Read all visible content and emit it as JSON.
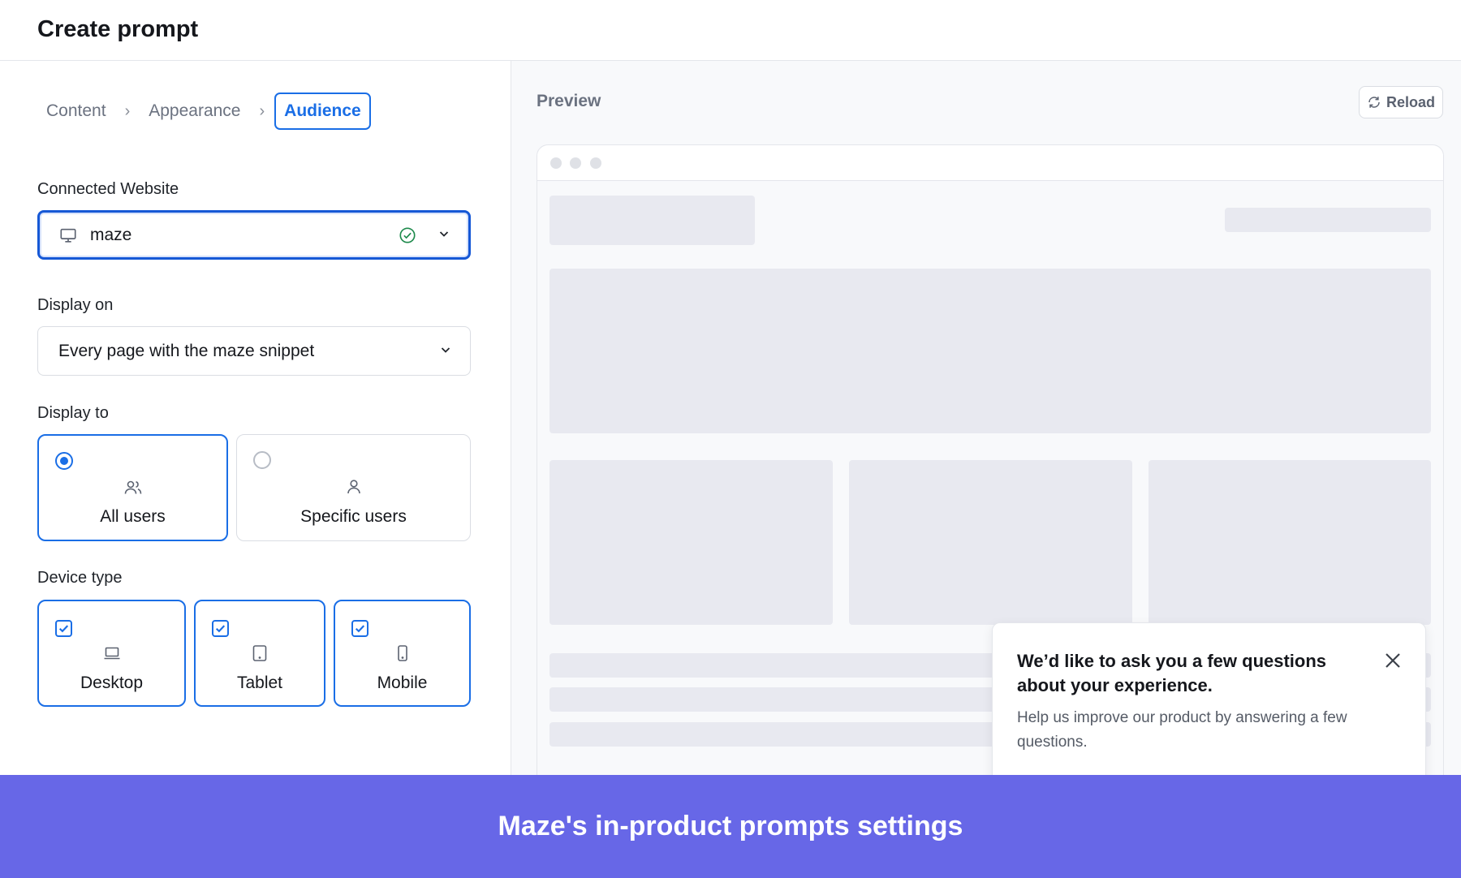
{
  "header": {
    "title": "Create prompt"
  },
  "steps": {
    "items": [
      {
        "label": "Content"
      },
      {
        "label": "Appearance"
      },
      {
        "label": "Audience"
      }
    ],
    "active": "Audience"
  },
  "connected_website": {
    "label": "Connected Website",
    "value": "maze",
    "icon": "monitor-icon",
    "status_icon": "check-circle-icon",
    "status_color": "#1e8a4c"
  },
  "display_on": {
    "label": "Display on",
    "value": "Every page with the maze snippet"
  },
  "display_to": {
    "label": "Display to",
    "options": [
      {
        "label": "All users",
        "icon": "users-icon",
        "selected": true
      },
      {
        "label": "Specific users",
        "icon": "user-icon",
        "selected": false
      }
    ]
  },
  "device_type": {
    "label": "Device type",
    "options": [
      {
        "label": "Desktop",
        "icon": "laptop-icon",
        "checked": true
      },
      {
        "label": "Tablet",
        "icon": "tablet-icon",
        "checked": true
      },
      {
        "label": "Mobile",
        "icon": "mobile-icon",
        "checked": true
      }
    ]
  },
  "preview": {
    "label": "Preview",
    "reload_label": "Reload",
    "popup": {
      "title": "We’d like to ask you a few questions about your experience.",
      "body": "Help us improve our product by answering a few questions."
    }
  },
  "banner": {
    "text": "Maze's in-product prompts settings"
  },
  "colors": {
    "accent": "#1a6ee6",
    "banner": "#6767e7",
    "skeleton": "#e8e9f0"
  }
}
